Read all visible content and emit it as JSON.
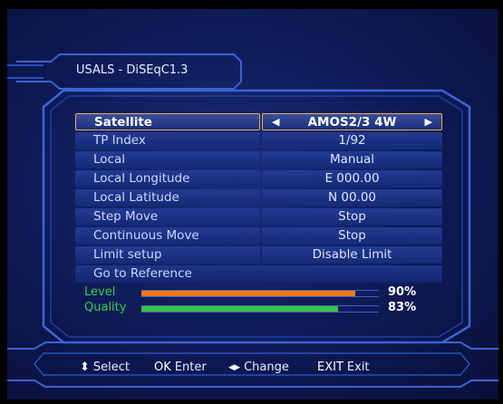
{
  "window": {
    "title": "USALS - DiSEqC1.3"
  },
  "menu": {
    "items": [
      {
        "label": "Satellite",
        "value": "AMOS2/3 4W"
      },
      {
        "label": "TP Index",
        "value": "1/92"
      },
      {
        "label": "Local",
        "value": "Manual"
      },
      {
        "label": "Local Longitude",
        "value": "E 000.00"
      },
      {
        "label": "Local Latitude",
        "value": "N 00.00"
      },
      {
        "label": "Step Move",
        "value": "Stop"
      },
      {
        "label": "Continuous Move",
        "value": "Stop"
      },
      {
        "label": "Limit setup",
        "value": "Disable Limit"
      },
      {
        "label": "Go to Reference"
      }
    ]
  },
  "signal": {
    "level": {
      "label": "Level",
      "percent_text": "90%",
      "value": 0.9,
      "color": "#f07a1a"
    },
    "quality": {
      "label": "Quality",
      "percent_text": "83%",
      "value": 0.83,
      "color": "#33c544"
    }
  },
  "footer": {
    "select": {
      "key": "⬍",
      "label": "Select"
    },
    "ok": {
      "key": "OK",
      "label": "Enter"
    },
    "change": {
      "key": "◂▸",
      "label": "Change"
    },
    "exit": {
      "key": "EXIT",
      "label": "Exit"
    }
  },
  "colors": {
    "background": "#0e1a55",
    "frame": "#3a63d4",
    "selected_border": "#e8b24a"
  }
}
